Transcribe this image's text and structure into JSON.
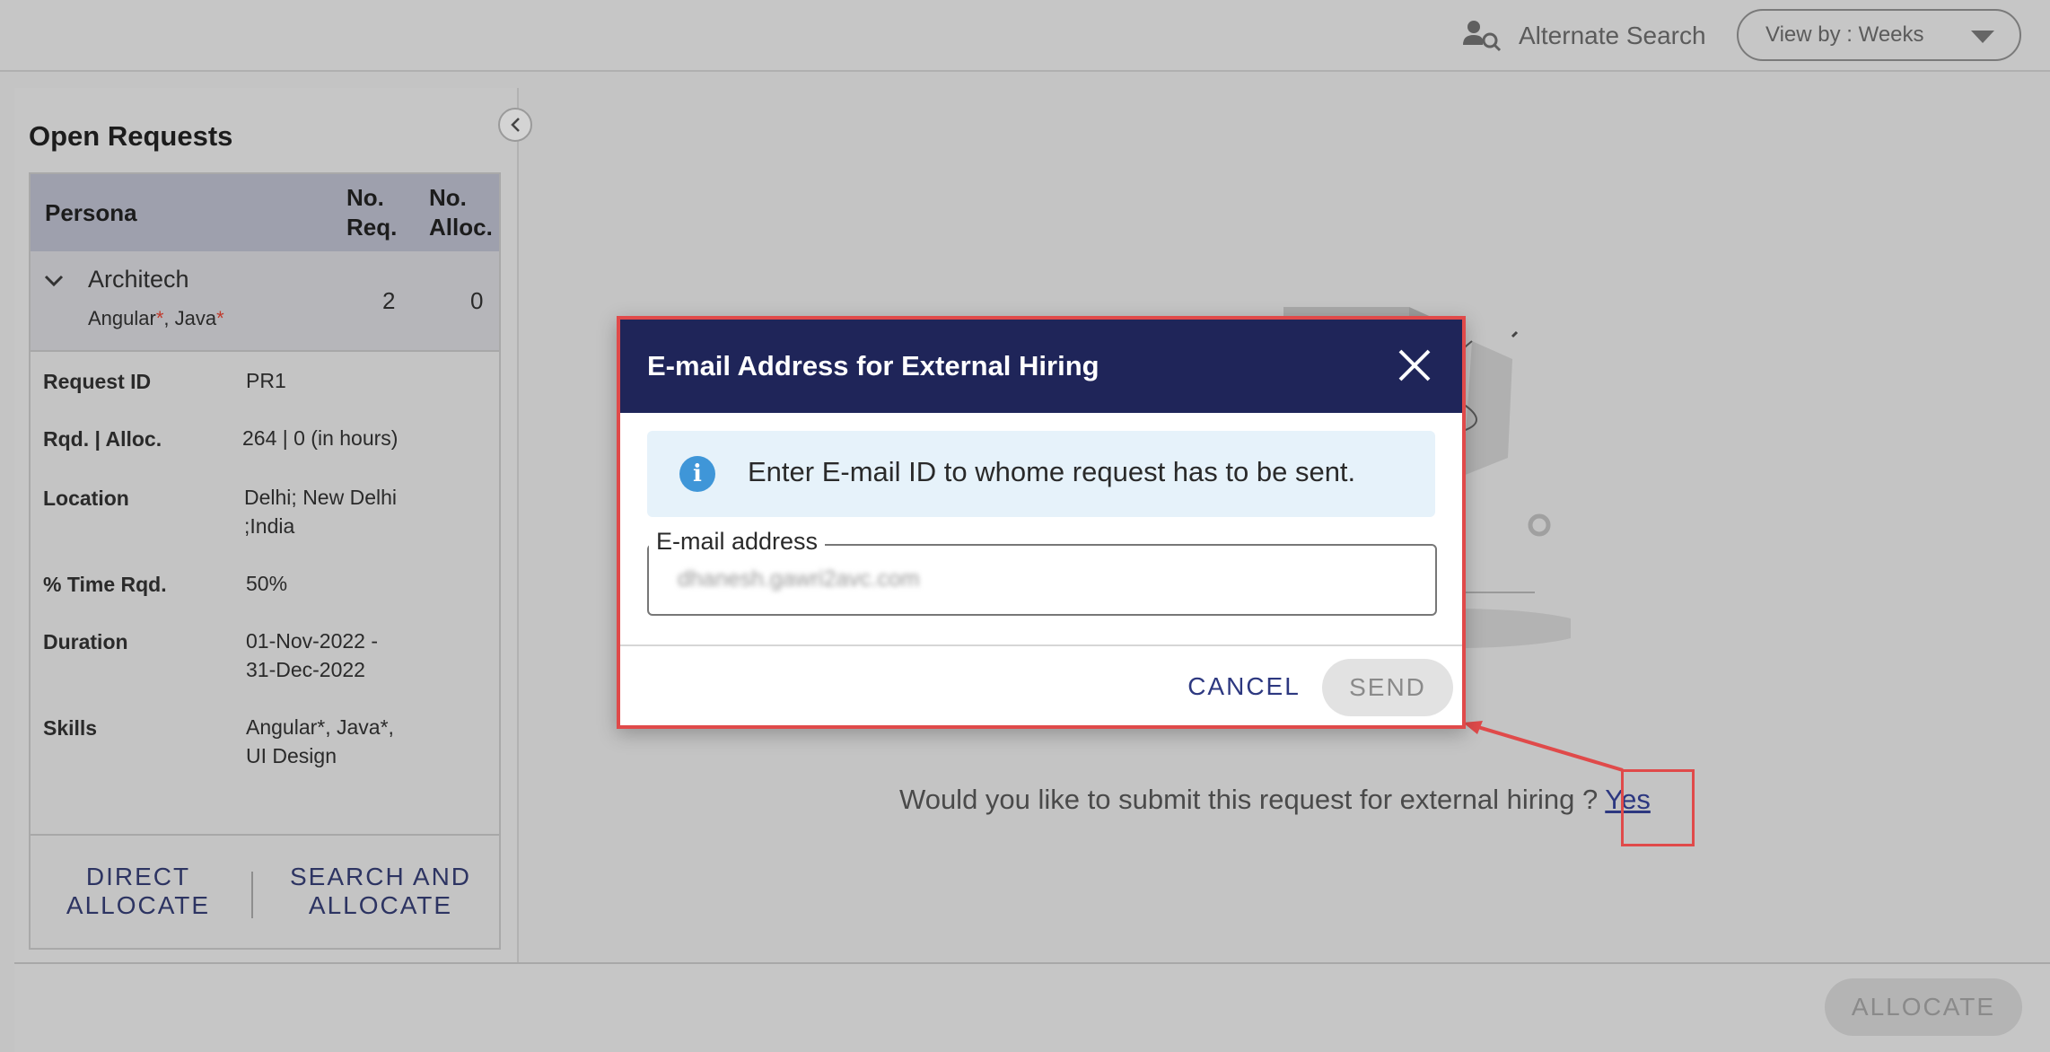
{
  "topbar": {
    "alternate_search_label": "Alternate Search",
    "alternate_search_icon": "user-search-icon",
    "view_by_label": "View by : Weeks"
  },
  "open_requests": {
    "title": "Open Requests",
    "columns": {
      "persona": "Persona",
      "no_req_line1": "No.",
      "no_req_line2": "Req.",
      "no_alloc_line1": "No.",
      "no_alloc_line2": "Alloc."
    },
    "group": {
      "name": "Architech",
      "skills": [
        {
          "name": "Angular",
          "required": true
        },
        {
          "name": "Java",
          "required": true
        }
      ],
      "no_req": "2",
      "no_alloc": "0"
    },
    "details": [
      {
        "label": "Request ID",
        "lines": [
          "PR1"
        ]
      },
      {
        "label": "Rqd. | Alloc.",
        "lines": [
          "264 | 0 (in hours)"
        ]
      },
      {
        "label": "Location",
        "lines": [
          "Delhi; New Delhi",
          ";India"
        ]
      },
      {
        "label": "% Time Rqd.",
        "lines": [
          "50%"
        ]
      },
      {
        "label": "Duration",
        "lines": [
          "01-Nov-2022 -",
          "31-Dec-2022"
        ]
      },
      {
        "label": "Skills",
        "lines": [
          "Angular*, Java*,",
          "UI Design"
        ]
      }
    ],
    "actions": {
      "direct_allocate_line1": "DIRECT",
      "direct_allocate_line2": "ALLOCATE",
      "search_allocate_line1": "SEARCH AND",
      "search_allocate_line2": "ALLOCATE"
    }
  },
  "main": {
    "external_hiring_prompt": "Would you like to submit this request for external hiring ?",
    "yes_link": "Yes"
  },
  "footer": {
    "allocate_label": "ALLOCATE"
  },
  "modal": {
    "title": "E-mail Address for External Hiring",
    "info_text": "Enter E-mail ID to whome request has to be sent.",
    "email_label": "E-mail address",
    "email_value": "dhanesh.gawri2avc.com",
    "cancel_label": "CANCEL",
    "send_label": "SEND"
  },
  "colors": {
    "modal_header": "#1f2559",
    "highlight": "#e04a4a",
    "link": "#2d3880",
    "info_icon": "#3f96d8"
  }
}
